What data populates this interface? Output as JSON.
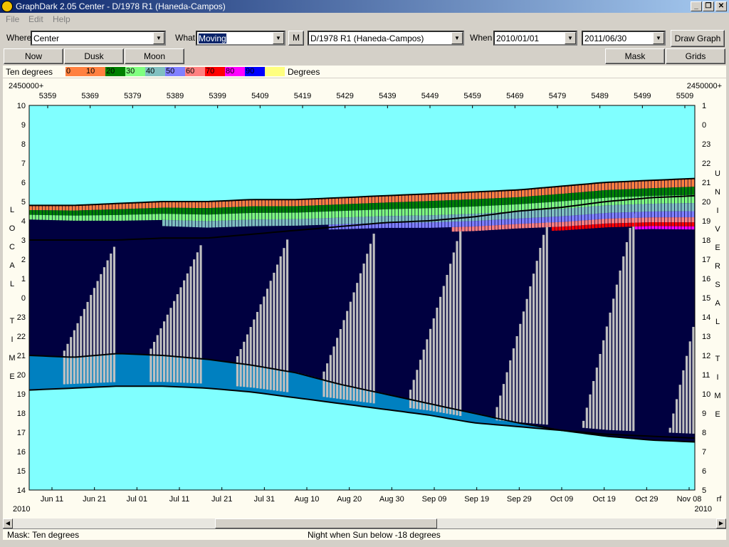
{
  "window": {
    "title": "GraphDark 2.05  Center  -  D/1978 R1 (Haneda-Campos)"
  },
  "menu": [
    "File",
    "Edit",
    "Help"
  ],
  "toolbar": {
    "where_label": "Where",
    "where_value": "Center",
    "what_label": "What",
    "what_value": "Moving",
    "m_button": "M",
    "object_value": "D/1978 R1 (Haneda-Campos)",
    "when_label": "When",
    "start_date": "2010/01/01",
    "end_date": "2011/06/30",
    "draw_button": "Draw Graph"
  },
  "buttons": {
    "now": "Now",
    "dusk": "Dusk",
    "moon": "Moon",
    "mask": "Mask",
    "grids": "Grids"
  },
  "scale": {
    "label": "Ten degrees",
    "unit": "Degrees",
    "items": [
      {
        "value": "0",
        "color": "#ff8040"
      },
      {
        "value": "10",
        "color": "#ff8040"
      },
      {
        "value": "20",
        "color": "#008000"
      },
      {
        "value": "30",
        "color": "#80ff80"
      },
      {
        "value": "40",
        "color": "#80c0c0"
      },
      {
        "value": "50",
        "color": "#8080ff"
      },
      {
        "value": "60",
        "color": "#ff8080"
      },
      {
        "value": "70",
        "color": "#ff0000"
      },
      {
        "value": "80",
        "color": "#ff00ff"
      },
      {
        "value": "90",
        "color": "#0000ff"
      },
      {
        "value": "",
        "color": "#ffff80"
      }
    ]
  },
  "chart_data": {
    "type": "heatmap",
    "jd_prefix": "2450000+",
    "top_ticks": [
      "5359",
      "5369",
      "5379",
      "5389",
      "5399",
      "5409",
      "5419",
      "5429",
      "5439",
      "5449",
      "5459",
      "5469",
      "5479",
      "5489",
      "5499",
      "5509"
    ],
    "bottom_ticks": [
      "Jun 11",
      "Jun 21",
      "Jul 01",
      "Jul 11",
      "Jul 21",
      "Jul 31",
      "Aug 10",
      "Aug 20",
      "Aug 30",
      "Sep 09",
      "Sep 19",
      "Sep 29",
      "Oct 09",
      "Oct 19",
      "Oct 29",
      "Nov 08"
    ],
    "left_ticks": [
      "10",
      "9",
      "8",
      "7",
      "6",
      "5",
      "4",
      "3",
      "2",
      "1",
      "0",
      "23",
      "22",
      "21",
      "20",
      "19",
      "18",
      "17",
      "16",
      "15",
      "14"
    ],
    "right_ticks": [
      "1",
      "0",
      "23",
      "22",
      "21",
      "20",
      "19",
      "18",
      "17",
      "16",
      "15",
      "14",
      "13",
      "12",
      "11",
      "10",
      "9",
      "8",
      "7",
      "6",
      "5"
    ],
    "left_axis_label": [
      "L",
      "O",
      "C",
      "A",
      "L",
      "",
      "T",
      "I",
      "M",
      "E"
    ],
    "right_axis_label": [
      "U",
      "N",
      "I",
      "V",
      "E",
      "R",
      "S",
      "A",
      "L",
      "",
      "T",
      "I",
      "M",
      "E"
    ],
    "bottom_left_year": "2010",
    "bottom_right_year": "2010",
    "right_corner": "rf",
    "x_start": "2010-06-06",
    "x_end": "2010-11-09",
    "y_axis": "local time, hours, 10 at top to 14 at bottom",
    "dusk_hours": [
      21.0,
      20.9,
      21.1,
      21.0,
      20.8,
      20.5,
      20.1,
      19.5,
      19.0,
      18.5,
      18.0,
      17.5,
      17.1,
      16.8,
      16.6,
      16.5
    ],
    "dawn_hours": [
      19.2,
      19.3,
      19.4,
      19.4,
      19.3,
      19.1,
      18.8,
      18.5,
      18.2,
      17.9,
      17.5,
      17.3,
      17.1,
      16.9,
      16.8,
      16.7
    ],
    "object_rise_hours": [
      4.8,
      4.8,
      4.9,
      5.0,
      5.0,
      5.1,
      5.1,
      5.2,
      5.3,
      5.4,
      5.5,
      5.6,
      5.8,
      6.0,
      6.1,
      6.2
    ],
    "object_set_hours": [
      3.0,
      3.0,
      3.0,
      3.1,
      3.1,
      3.3,
      3.5,
      3.7,
      3.9,
      4.0,
      4.2,
      4.5,
      4.7,
      5.0,
      5.2,
      5.3
    ],
    "colors": {
      "daylight": "#80ffff",
      "dark_sky": "#000040",
      "twilight": "#0080c0",
      "moonlight": "#c0c0c0"
    }
  },
  "status": {
    "mask": "Mask:  Ten degrees",
    "night": "Night when Sun below -18 degrees"
  }
}
